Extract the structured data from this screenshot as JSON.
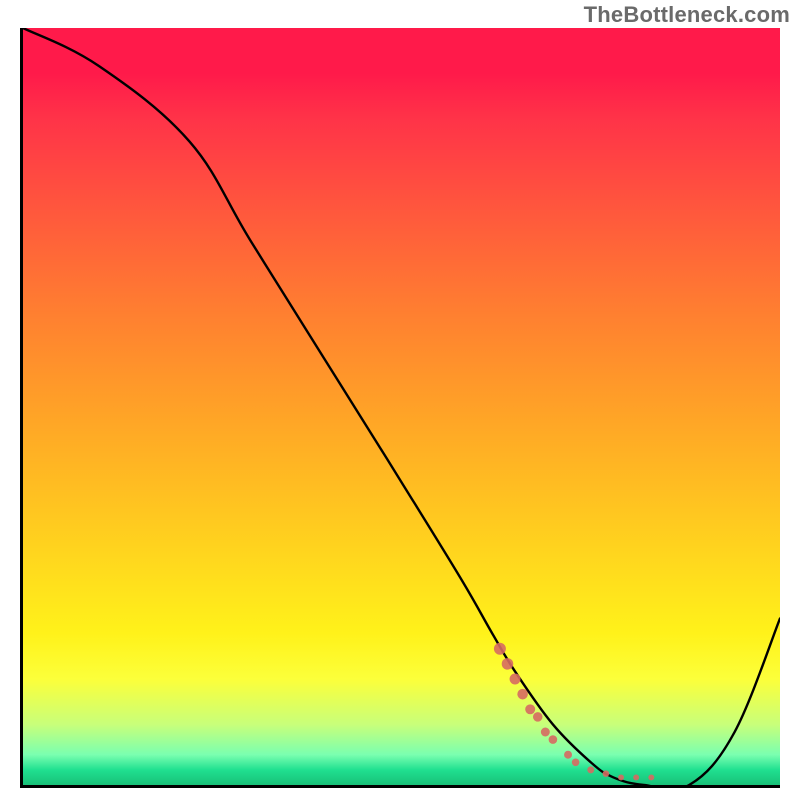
{
  "watermark": "TheBottleneck.com",
  "chart_data": {
    "type": "line",
    "title": "",
    "xlabel": "",
    "ylabel": "",
    "xlim": [
      0,
      100
    ],
    "ylim": [
      0,
      100
    ],
    "series": [
      {
        "name": "bottleneck-curve",
        "x": [
          0,
          10,
          22,
          30,
          40,
          50,
          58,
          62,
          65,
          70,
          75,
          78,
          82,
          88,
          94,
          100
        ],
        "y": [
          100,
          95,
          85,
          72,
          56,
          40,
          27,
          20,
          15,
          8,
          3,
          1,
          0,
          0,
          7,
          22
        ]
      }
    ],
    "marker_region": {
      "note": "salmon dotted markers near valley floor",
      "x": [
        63,
        64,
        65,
        66,
        67,
        68,
        69,
        70,
        72,
        73,
        75,
        77,
        79,
        81,
        83
      ],
      "y": [
        18,
        16,
        14,
        12,
        10,
        9,
        7,
        6,
        4,
        3,
        2,
        1.5,
        1,
        1,
        1
      ]
    },
    "gradient_stops": [
      {
        "pos": 0.0,
        "color": "#ff1a4a"
      },
      {
        "pos": 0.25,
        "color": "#ff5a3c"
      },
      {
        "pos": 0.52,
        "color": "#ffa626"
      },
      {
        "pos": 0.8,
        "color": "#fff21a"
      },
      {
        "pos": 0.96,
        "color": "#7affb0"
      },
      {
        "pos": 1.0,
        "color": "#18c078"
      }
    ]
  }
}
